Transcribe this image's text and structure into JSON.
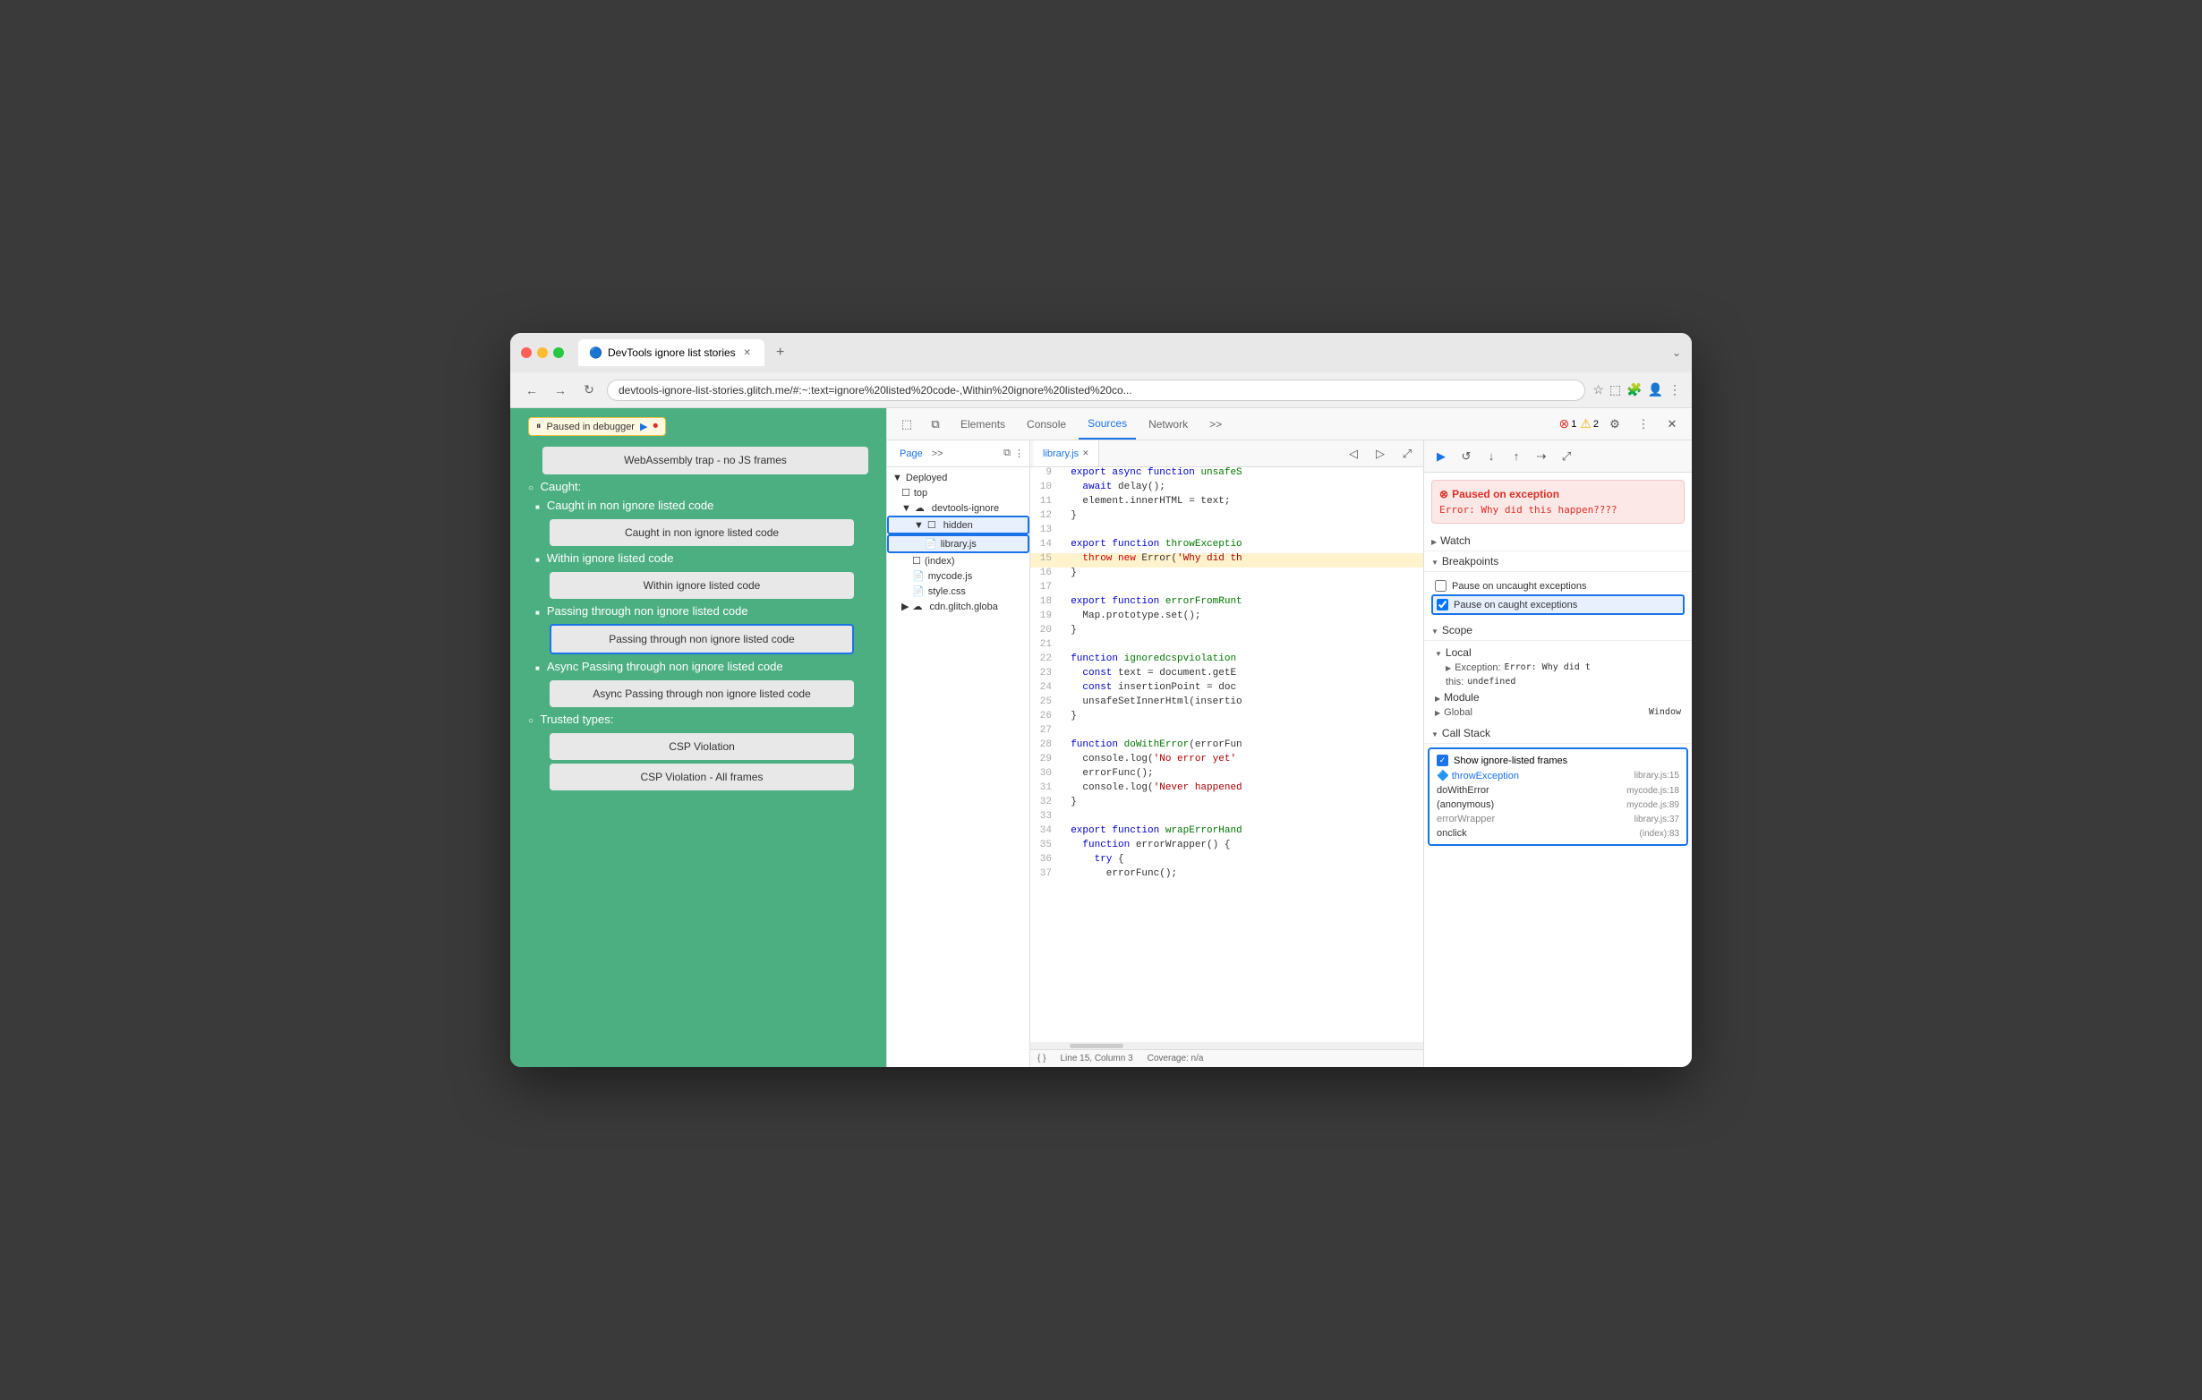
{
  "browser": {
    "traffic_lights": [
      "red",
      "yellow",
      "green"
    ],
    "tab_title": "DevTools ignore list stories",
    "tab_icon": "🔵",
    "new_tab_icon": "+",
    "address_url": "devtools-ignore-list-stories.glitch.me/#:~:text=ignore%20listed%20code-,Within%20ignore%20listed%20co...",
    "nav_back": "←",
    "nav_forward": "→",
    "nav_refresh": "↻",
    "window_more": "⌄"
  },
  "page": {
    "paused_badge": "Paused in debugger",
    "webasm_box": "WebAssembly trap - no JS frames",
    "caught_section": {
      "label": "Caught:",
      "items": [
        {
          "label": "Caught in non ignore listed code",
          "btn": "Caught in non ignore listed code"
        },
        {
          "label": "Within ignore listed code",
          "btn": "Within ignore listed code"
        },
        {
          "label": "Passing through non ignore listed code",
          "btn": "Passing through non ignore listed code",
          "highlighted": true
        },
        {
          "label": "Async Passing through non ignore listed code",
          "btn": "Async Passing through non ignore listed code"
        }
      ]
    },
    "trusted_section": {
      "label": "Trusted types:",
      "items": [
        "CSP Violation",
        "CSP Violation - All frames"
      ]
    }
  },
  "devtools": {
    "tabs": [
      "Elements",
      "Console",
      "Sources",
      "Network",
      ">>"
    ],
    "active_tab": "Sources",
    "error_count": "1",
    "warn_count": "2",
    "toolbar_icons": [
      "⬚",
      "⧉"
    ],
    "settings_icon": "⚙",
    "more_icon": "⋮",
    "close_icon": "✕"
  },
  "sources": {
    "sidebar_tabs": [
      "Page",
      ">>"
    ],
    "sidebar_more": "⋮",
    "sidebar_icon": "⧉",
    "tree": [
      {
        "label": "Deployed",
        "indent": 0,
        "icon": "▼",
        "type": "section"
      },
      {
        "label": "top",
        "indent": 1,
        "icon": "☐",
        "type": "folder"
      },
      {
        "label": "devtools-ignore",
        "indent": 1,
        "icon": "☁",
        "type": "cloud"
      },
      {
        "label": "hidden",
        "indent": 2,
        "icon": "☐",
        "type": "folder",
        "highlighted": true
      },
      {
        "label": "library.js",
        "indent": 3,
        "icon": "📄",
        "type": "file",
        "highlighted": true,
        "selected": true
      },
      {
        "label": "(index)",
        "indent": 2,
        "icon": "☐",
        "type": "file"
      },
      {
        "label": "mycode.js",
        "indent": 2,
        "icon": "📄",
        "type": "file",
        "color": "red"
      },
      {
        "label": "style.css",
        "indent": 2,
        "icon": "📄",
        "type": "file",
        "color": "red"
      },
      {
        "label": "cdn.glitch.globa",
        "indent": 1,
        "icon": "☁",
        "type": "cloud"
      }
    ],
    "editor_tab": "library.js",
    "code_lines": [
      {
        "num": 9,
        "content": "  export async function unsafeS",
        "highlight": false
      },
      {
        "num": 10,
        "content": "    await delay();",
        "highlight": false
      },
      {
        "num": 11,
        "content": "    element.innerHTML = text;",
        "highlight": false
      },
      {
        "num": 12,
        "content": "  }",
        "highlight": false
      },
      {
        "num": 13,
        "content": "",
        "highlight": false
      },
      {
        "num": 14,
        "content": "  export function throwExceptio",
        "highlight": false
      },
      {
        "num": 15,
        "content": "    throw new Error('Why did th",
        "highlight": true
      },
      {
        "num": 16,
        "content": "  }",
        "highlight": false
      },
      {
        "num": 17,
        "content": "",
        "highlight": false
      },
      {
        "num": 18,
        "content": "  export function errorFromRunt",
        "highlight": false
      },
      {
        "num": 19,
        "content": "    Map.prototype.set();",
        "highlight": false
      },
      {
        "num": 20,
        "content": "  }",
        "highlight": false
      },
      {
        "num": 21,
        "content": "",
        "highlight": false
      },
      {
        "num": 22,
        "content": "  function ignoredcspviolation",
        "highlight": false
      },
      {
        "num": 23,
        "content": "    const text = document.getE",
        "highlight": false
      },
      {
        "num": 24,
        "content": "    const insertionPoint = doc",
        "highlight": false
      },
      {
        "num": 25,
        "content": "    unsafeSetInnerHtml(insertio",
        "highlight": false
      },
      {
        "num": 26,
        "content": "  }",
        "highlight": false
      },
      {
        "num": 27,
        "content": "",
        "highlight": false
      },
      {
        "num": 28,
        "content": "  function doWithError(errorFun",
        "highlight": false
      },
      {
        "num": 29,
        "content": "    console.log('No error yet'",
        "highlight": false
      },
      {
        "num": 30,
        "content": "    errorFunc();",
        "highlight": false
      },
      {
        "num": 31,
        "content": "    console.log('Never happened",
        "highlight": false
      },
      {
        "num": 32,
        "content": "  }",
        "highlight": false
      },
      {
        "num": 33,
        "content": "",
        "highlight": false
      },
      {
        "num": 34,
        "content": "  export function wrapErrorHand",
        "highlight": false
      },
      {
        "num": 35,
        "content": "    function errorWrapper() {",
        "highlight": false
      },
      {
        "num": 36,
        "content": "      try {",
        "highlight": false
      },
      {
        "num": 37,
        "content": "        errorFunc();",
        "highlight": false
      }
    ],
    "status_bar": {
      "line_col": "Line 15, Column 3",
      "coverage": "Coverage: n/a",
      "format_icon": "{ }"
    }
  },
  "debugger": {
    "toolbar_btns": [
      "▶",
      "↺",
      "↓",
      "↑",
      "⇢",
      "⤢"
    ],
    "exception_title": "Paused on exception",
    "exception_msg": "Error: Why did this happen????",
    "watch_label": "Watch",
    "breakpoints_label": "Breakpoints",
    "pause_uncaught_label": "Pause on uncaught exceptions",
    "pause_caught_label": "Pause on caught exceptions",
    "pause_caught_checked": true,
    "scope_label": "Scope",
    "local_label": "Local",
    "exception_scope": "Exception: Error: Why did t",
    "this_scope": "this: undefined",
    "module_label": "Module",
    "global_label": "Global",
    "global_value": "Window",
    "callstack_label": "Call Stack",
    "show_frames_label": "Show ignore-listed frames",
    "call_stack": [
      {
        "fn": "throwException",
        "loc": "library.js:15",
        "active": true,
        "dimmed": true
      },
      {
        "fn": "doWithError",
        "loc": "mycode.js:18",
        "active": false,
        "dimmed": false
      },
      {
        "fn": "(anonymous)",
        "loc": "mycode.js:89",
        "active": false,
        "dimmed": false
      },
      {
        "fn": "errorWrapper",
        "loc": "library.js:37",
        "active": false,
        "dimmed": true
      },
      {
        "fn": "onclick",
        "loc": "(index):83",
        "active": false,
        "dimmed": false
      }
    ]
  }
}
